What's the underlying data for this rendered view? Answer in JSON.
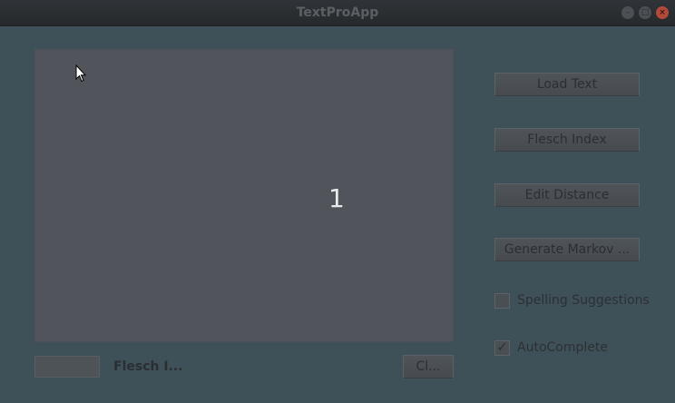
{
  "window": {
    "title": "TextProApp",
    "controls": {
      "minimize_icon": "minimize-icon",
      "maximize_icon": "maximize-icon",
      "close_icon": "close-icon"
    }
  },
  "editor": {
    "overlay_number": "1"
  },
  "buttons": {
    "load_text": "Load Text",
    "flesch_index": "Flesch Index",
    "edit_distance": "Edit Distance",
    "generate_markov": "Generate Markov ...",
    "clear": "Cl..."
  },
  "checkboxes": {
    "spelling_suggestions": {
      "label": "Spelling Suggestions",
      "checked": false
    },
    "autocomplete": {
      "label": "AutoComplete",
      "checked": true,
      "mark": "✓"
    }
  },
  "flesch": {
    "value": "",
    "label": "Flesch I..."
  },
  "colors": {
    "background": "#3f5158",
    "text_area": "#51555b",
    "title_bar": "#2f3438",
    "close_button": "#b24a3a"
  }
}
